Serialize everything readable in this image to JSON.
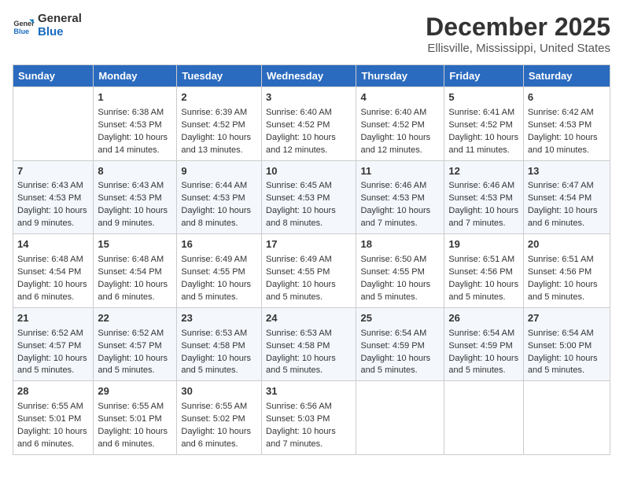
{
  "header": {
    "logo_line1": "General",
    "logo_line2": "Blue",
    "month_title": "December 2025",
    "location": "Ellisville, Mississippi, United States"
  },
  "days_of_week": [
    "Sunday",
    "Monday",
    "Tuesday",
    "Wednesday",
    "Thursday",
    "Friday",
    "Saturday"
  ],
  "weeks": [
    [
      {
        "day": "",
        "sunrise": "",
        "sunset": "",
        "daylight": ""
      },
      {
        "day": "1",
        "sunrise": "Sunrise: 6:38 AM",
        "sunset": "Sunset: 4:53 PM",
        "daylight": "Daylight: 10 hours and 14 minutes."
      },
      {
        "day": "2",
        "sunrise": "Sunrise: 6:39 AM",
        "sunset": "Sunset: 4:52 PM",
        "daylight": "Daylight: 10 hours and 13 minutes."
      },
      {
        "day": "3",
        "sunrise": "Sunrise: 6:40 AM",
        "sunset": "Sunset: 4:52 PM",
        "daylight": "Daylight: 10 hours and 12 minutes."
      },
      {
        "day": "4",
        "sunrise": "Sunrise: 6:40 AM",
        "sunset": "Sunset: 4:52 PM",
        "daylight": "Daylight: 10 hours and 12 minutes."
      },
      {
        "day": "5",
        "sunrise": "Sunrise: 6:41 AM",
        "sunset": "Sunset: 4:52 PM",
        "daylight": "Daylight: 10 hours and 11 minutes."
      },
      {
        "day": "6",
        "sunrise": "Sunrise: 6:42 AM",
        "sunset": "Sunset: 4:53 PM",
        "daylight": "Daylight: 10 hours and 10 minutes."
      }
    ],
    [
      {
        "day": "7",
        "sunrise": "Sunrise: 6:43 AM",
        "sunset": "Sunset: 4:53 PM",
        "daylight": "Daylight: 10 hours and 9 minutes."
      },
      {
        "day": "8",
        "sunrise": "Sunrise: 6:43 AM",
        "sunset": "Sunset: 4:53 PM",
        "daylight": "Daylight: 10 hours and 9 minutes."
      },
      {
        "day": "9",
        "sunrise": "Sunrise: 6:44 AM",
        "sunset": "Sunset: 4:53 PM",
        "daylight": "Daylight: 10 hours and 8 minutes."
      },
      {
        "day": "10",
        "sunrise": "Sunrise: 6:45 AM",
        "sunset": "Sunset: 4:53 PM",
        "daylight": "Daylight: 10 hours and 8 minutes."
      },
      {
        "day": "11",
        "sunrise": "Sunrise: 6:46 AM",
        "sunset": "Sunset: 4:53 PM",
        "daylight": "Daylight: 10 hours and 7 minutes."
      },
      {
        "day": "12",
        "sunrise": "Sunrise: 6:46 AM",
        "sunset": "Sunset: 4:53 PM",
        "daylight": "Daylight: 10 hours and 7 minutes."
      },
      {
        "day": "13",
        "sunrise": "Sunrise: 6:47 AM",
        "sunset": "Sunset: 4:54 PM",
        "daylight": "Daylight: 10 hours and 6 minutes."
      }
    ],
    [
      {
        "day": "14",
        "sunrise": "Sunrise: 6:48 AM",
        "sunset": "Sunset: 4:54 PM",
        "daylight": "Daylight: 10 hours and 6 minutes."
      },
      {
        "day": "15",
        "sunrise": "Sunrise: 6:48 AM",
        "sunset": "Sunset: 4:54 PM",
        "daylight": "Daylight: 10 hours and 6 minutes."
      },
      {
        "day": "16",
        "sunrise": "Sunrise: 6:49 AM",
        "sunset": "Sunset: 4:55 PM",
        "daylight": "Daylight: 10 hours and 5 minutes."
      },
      {
        "day": "17",
        "sunrise": "Sunrise: 6:49 AM",
        "sunset": "Sunset: 4:55 PM",
        "daylight": "Daylight: 10 hours and 5 minutes."
      },
      {
        "day": "18",
        "sunrise": "Sunrise: 6:50 AM",
        "sunset": "Sunset: 4:55 PM",
        "daylight": "Daylight: 10 hours and 5 minutes."
      },
      {
        "day": "19",
        "sunrise": "Sunrise: 6:51 AM",
        "sunset": "Sunset: 4:56 PM",
        "daylight": "Daylight: 10 hours and 5 minutes."
      },
      {
        "day": "20",
        "sunrise": "Sunrise: 6:51 AM",
        "sunset": "Sunset: 4:56 PM",
        "daylight": "Daylight: 10 hours and 5 minutes."
      }
    ],
    [
      {
        "day": "21",
        "sunrise": "Sunrise: 6:52 AM",
        "sunset": "Sunset: 4:57 PM",
        "daylight": "Daylight: 10 hours and 5 minutes."
      },
      {
        "day": "22",
        "sunrise": "Sunrise: 6:52 AM",
        "sunset": "Sunset: 4:57 PM",
        "daylight": "Daylight: 10 hours and 5 minutes."
      },
      {
        "day": "23",
        "sunrise": "Sunrise: 6:53 AM",
        "sunset": "Sunset: 4:58 PM",
        "daylight": "Daylight: 10 hours and 5 minutes."
      },
      {
        "day": "24",
        "sunrise": "Sunrise: 6:53 AM",
        "sunset": "Sunset: 4:58 PM",
        "daylight": "Daylight: 10 hours and 5 minutes."
      },
      {
        "day": "25",
        "sunrise": "Sunrise: 6:54 AM",
        "sunset": "Sunset: 4:59 PM",
        "daylight": "Daylight: 10 hours and 5 minutes."
      },
      {
        "day": "26",
        "sunrise": "Sunrise: 6:54 AM",
        "sunset": "Sunset: 4:59 PM",
        "daylight": "Daylight: 10 hours and 5 minutes."
      },
      {
        "day": "27",
        "sunrise": "Sunrise: 6:54 AM",
        "sunset": "Sunset: 5:00 PM",
        "daylight": "Daylight: 10 hours and 5 minutes."
      }
    ],
    [
      {
        "day": "28",
        "sunrise": "Sunrise: 6:55 AM",
        "sunset": "Sunset: 5:01 PM",
        "daylight": "Daylight: 10 hours and 6 minutes."
      },
      {
        "day": "29",
        "sunrise": "Sunrise: 6:55 AM",
        "sunset": "Sunset: 5:01 PM",
        "daylight": "Daylight: 10 hours and 6 minutes."
      },
      {
        "day": "30",
        "sunrise": "Sunrise: 6:55 AM",
        "sunset": "Sunset: 5:02 PM",
        "daylight": "Daylight: 10 hours and 6 minutes."
      },
      {
        "day": "31",
        "sunrise": "Sunrise: 6:56 AM",
        "sunset": "Sunset: 5:03 PM",
        "daylight": "Daylight: 10 hours and 7 minutes."
      },
      {
        "day": "",
        "sunrise": "",
        "sunset": "",
        "daylight": ""
      },
      {
        "day": "",
        "sunrise": "",
        "sunset": "",
        "daylight": ""
      },
      {
        "day": "",
        "sunrise": "",
        "sunset": "",
        "daylight": ""
      }
    ]
  ]
}
